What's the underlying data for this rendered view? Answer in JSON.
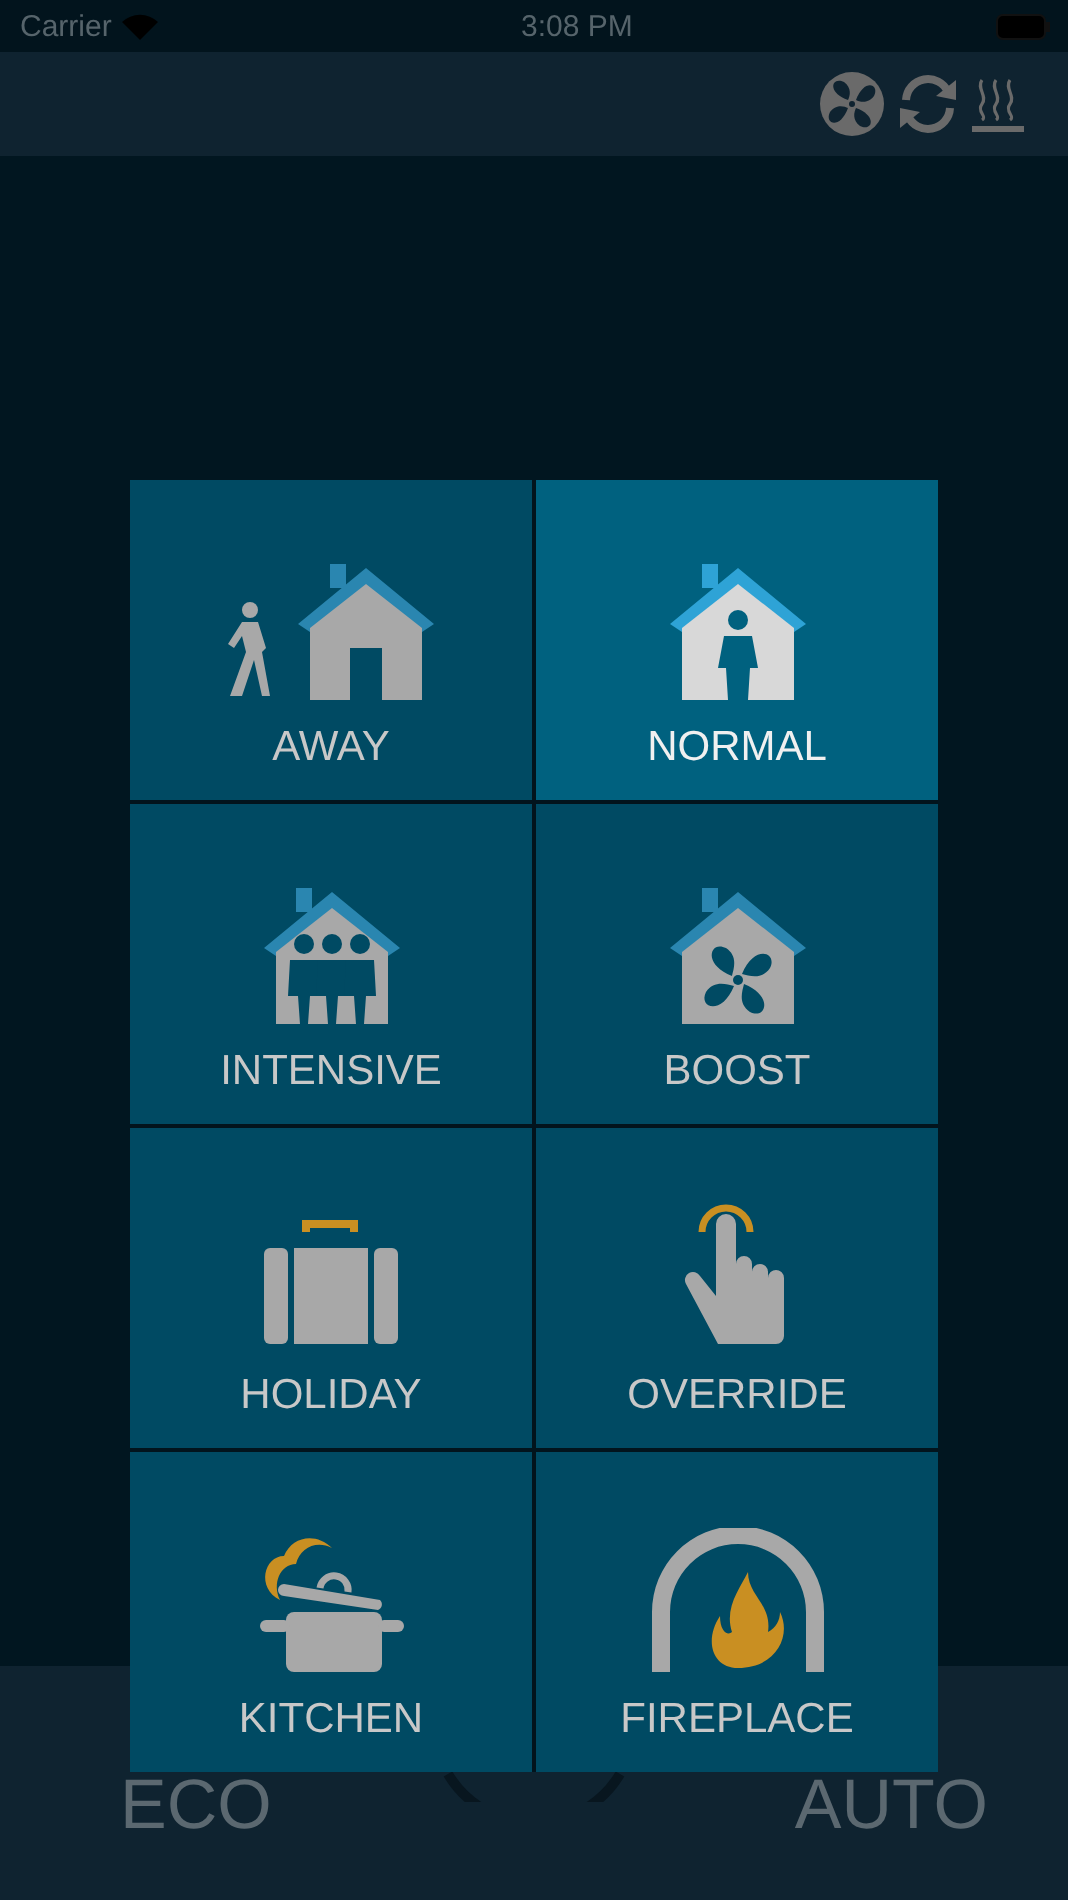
{
  "status_bar": {
    "carrier": "Carrier",
    "time": "3:08 PM"
  },
  "bottom_bar": {
    "left_label": "ECO",
    "right_label": "AUTO"
  },
  "modes": [
    {
      "kind": "away",
      "label": "AWAY",
      "selected": false
    },
    {
      "kind": "normal",
      "label": "NORMAL",
      "selected": true
    },
    {
      "kind": "intensive",
      "label": "INTENSIVE",
      "selected": false
    },
    {
      "kind": "boost",
      "label": "BOOST",
      "selected": false
    },
    {
      "kind": "holiday",
      "label": "HOLIDAY",
      "selected": false
    },
    {
      "kind": "override",
      "label": "OVERRIDE",
      "selected": false
    },
    {
      "kind": "kitchen",
      "label": "KITCHEN",
      "selected": false
    },
    {
      "kind": "fireplace",
      "label": "FIREPLACE",
      "selected": false
    }
  ]
}
